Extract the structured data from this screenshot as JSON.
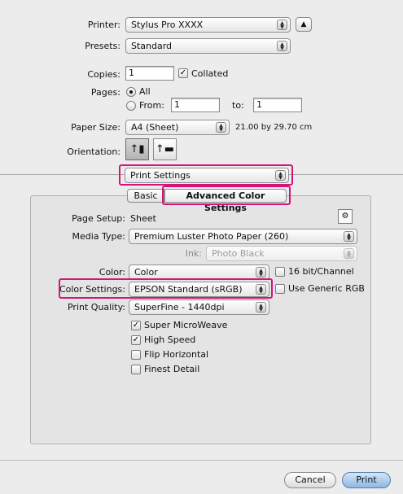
{
  "printer": {
    "label": "Printer:",
    "value": "Stylus Pro XXXX"
  },
  "presets": {
    "label": "Presets:",
    "value": "Standard"
  },
  "copies": {
    "label": "Copies:",
    "value": "1",
    "collated_label": "Collated"
  },
  "pages": {
    "label": "Pages:",
    "all_label": "All",
    "from_label": "From:",
    "from_value": "1",
    "to_label": "to:",
    "to_value": "1"
  },
  "paper_size": {
    "label": "Paper Size:",
    "value": "A4 (Sheet)",
    "dimensions": "21.00 by 29.70 cm"
  },
  "orientation": {
    "label": "Orientation:"
  },
  "panel_menu": {
    "value": "Print Settings"
  },
  "tabs": {
    "basic": "Basic",
    "advanced": "Advanced Color Settings"
  },
  "page_setup": {
    "label": "Page Setup:",
    "value": "Sheet"
  },
  "media_type": {
    "label": "Media Type:",
    "value": "Premium Luster Photo Paper (260)"
  },
  "ink": {
    "label": "Ink:",
    "value": "Photo Black"
  },
  "color": {
    "label": "Color:",
    "value": "Color",
    "bit16_label": "16 bit/Channel"
  },
  "color_settings": {
    "label": "Color Settings:",
    "value": "EPSON Standard (sRGB)",
    "generic_label": "Use Generic RGB"
  },
  "print_quality": {
    "label": "Print Quality:",
    "value": "SuperFine - 1440dpi"
  },
  "options": [
    {
      "label": "Super MicroWeave",
      "checked": true
    },
    {
      "label": "High Speed",
      "checked": true
    },
    {
      "label": "Flip Horizontal",
      "checked": false
    },
    {
      "label": "Finest Detail",
      "checked": false
    }
  ],
  "buttons": {
    "cancel": "Cancel",
    "print": "Print"
  },
  "colors": {
    "highlight": "#d4147a",
    "default_button": "#a8c8ea"
  }
}
